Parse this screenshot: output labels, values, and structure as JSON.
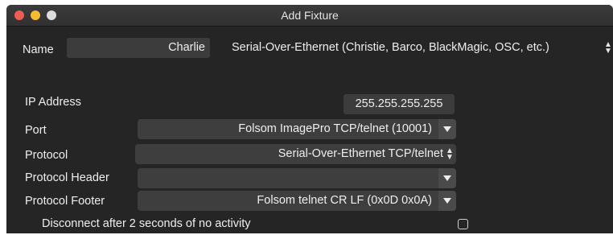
{
  "window": {
    "title": "Add Fixture",
    "traffic_colors": {
      "close": "#ee5d54",
      "minimize": "#f6bc31",
      "zoom": "#dcdcdc"
    }
  },
  "name_row": {
    "label": "Name",
    "value": "Charlie",
    "type_select": "Serial-Over-Ethernet (Christie, Barco, BlackMagic, OSC, etc.)"
  },
  "ip_address": {
    "label": "IP Address",
    "value": "255.255.255.255"
  },
  "port": {
    "label": "Port",
    "value": "Folsom ImagePro TCP/telnet (10001)"
  },
  "protocol": {
    "label": "Protocol",
    "value": "Serial-Over-Ethernet TCP/telnet"
  },
  "protocol_header": {
    "label": "Protocol Header",
    "value": ""
  },
  "protocol_footer": {
    "label": "Protocol Footer",
    "value": "Folsom telnet CR LF (0x0D 0x0A)"
  },
  "disconnect": {
    "label": "Disconnect after 2 seconds of no activity",
    "checked": false
  },
  "colors": {
    "background": "#252525",
    "field": "#3c3c3c",
    "text": "#eeeeee"
  }
}
